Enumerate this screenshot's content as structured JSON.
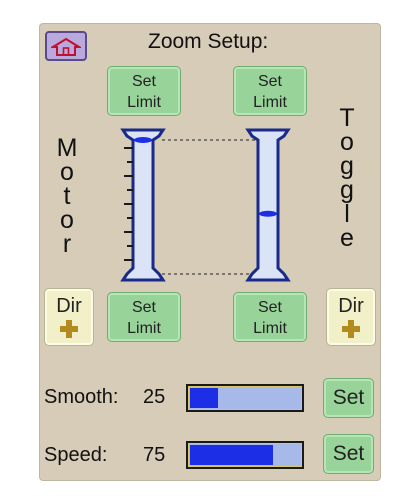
{
  "header": {
    "title": "Zoom Setup:",
    "home_icon": "home-icon"
  },
  "set_limit": {
    "line1": "Set",
    "line2": "Limit"
  },
  "side_labels": {
    "left": [
      "M",
      "o",
      "t",
      "o",
      "r"
    ],
    "right": [
      "T",
      "o",
      "g",
      "g",
      "l",
      "e"
    ]
  },
  "dir_button": {
    "label": "Dir",
    "icon": "plus-icon"
  },
  "rows": {
    "smooth": {
      "label": "Smooth:",
      "value": "25",
      "fill": 0.25,
      "button": "Set"
    },
    "speed": {
      "label": "Speed:",
      "value": "75",
      "fill": 0.75,
      "button": "Set"
    }
  },
  "sliders": {
    "left_position": 0.0,
    "right_position": 0.55
  },
  "colors": {
    "panel": "#d6ccb8",
    "green_button": "#98d39a",
    "bar_fill": "#1d2fe6",
    "bar_bg": "#a6b9e8",
    "column": "#dbe4f7",
    "outline": "#1a2a8a",
    "dir_button": "#f1f0c8"
  }
}
